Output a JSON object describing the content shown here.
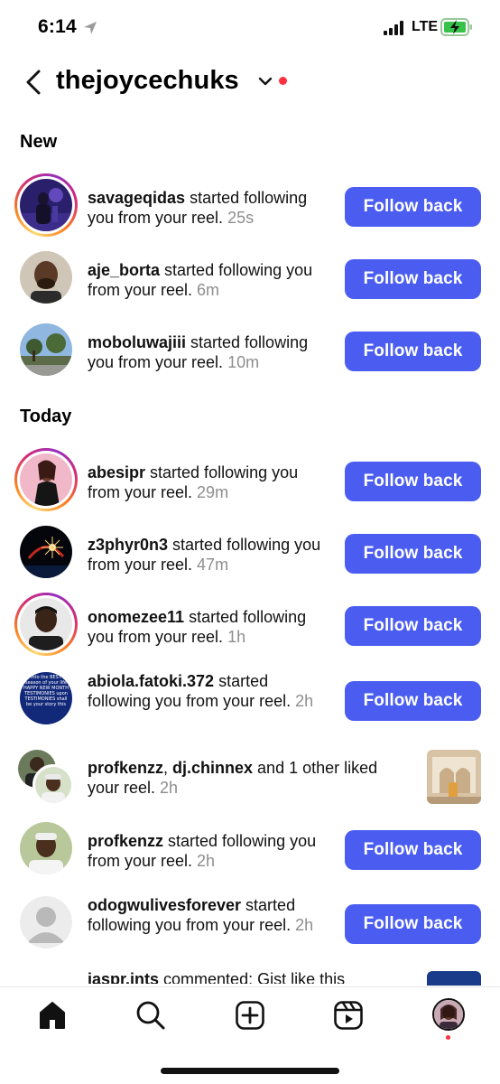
{
  "status_bar": {
    "time": "6:14",
    "network": "LTE"
  },
  "header": {
    "account_name": "thejoycechuks"
  },
  "sections": {
    "new": "New",
    "today": "Today"
  },
  "rows": [
    {
      "username": "savageqidas",
      "text": " started following you from your reel. ",
      "time": "25s",
      "button": "Follow back"
    },
    {
      "username": "aje_borta",
      "text": " started following you from your reel. ",
      "time": "6m",
      "button": "Follow back"
    },
    {
      "username": "moboluwajiii",
      "text": " started following you from your reel. ",
      "time": "10m",
      "button": "Follow back"
    },
    {
      "username": "abesipr",
      "text": " started following you from your reel. ",
      "time": "29m",
      "button": "Follow back"
    },
    {
      "username": "z3phyr0n3",
      "text": " started following you from your reel. ",
      "time": "47m",
      "button": "Follow back"
    },
    {
      "username": "onomezee11",
      "text": " started following you from your reel. ",
      "time": "1h",
      "button": "Follow back"
    },
    {
      "username": "abiola.fatoki.372",
      "text": " started following you from your reel. ",
      "time": "2h",
      "button": "Follow back"
    },
    {
      "username": "profkenzz",
      "sep": ", ",
      "username2": "dj.chinnex",
      "text": " and 1 other liked your reel. ",
      "time": "2h"
    },
    {
      "username": "profkenzz",
      "text": " started following you from your reel. ",
      "time": "2h",
      "button": "Follow back"
    },
    {
      "username": "odogwulivesforever",
      "text": " started following you from your reel. ",
      "time": "2h",
      "button": "Follow back"
    }
  ],
  "partial_row": {
    "username": "jaspr.ints",
    "text": " commented: Gist like this"
  },
  "abiola_avatar_text": "into the BEST season of your life HAPPY NEW MONTH TESTIMONIES upon TESTIMONIES shall be your story this",
  "tab_bar": {
    "icons": [
      "home-icon",
      "search-icon",
      "create-icon",
      "reels-icon",
      "profile-avatar"
    ]
  },
  "colors": {
    "button": "#4a5df0",
    "notification_dot": "#ff3040",
    "timestamp": "#8e8e8e"
  }
}
